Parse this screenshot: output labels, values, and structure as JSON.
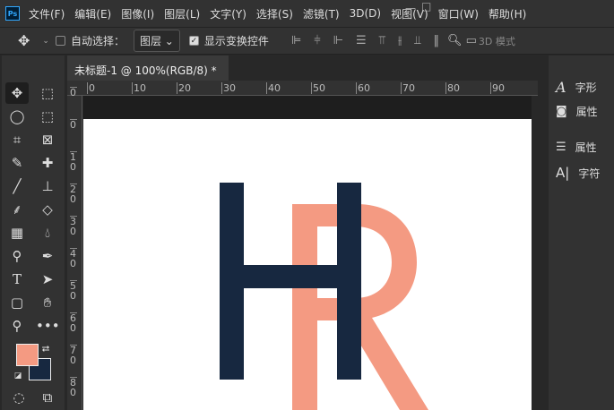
{
  "app": {
    "logo": "Ps"
  },
  "menu": [
    "文件(F)",
    "编辑(E)",
    "图像(I)",
    "图层(L)",
    "文字(Y)",
    "选择(S)",
    "滤镜(T)",
    "3D(D)",
    "视图(V)",
    "窗口(W)",
    "帮助(H)"
  ],
  "options": {
    "auto_select_label": "自动选择：",
    "auto_select_checked": false,
    "target": "图层",
    "show_transform_label": "显示变换控件",
    "show_transform_checked": true,
    "mode_3d": "3D 模式"
  },
  "document": {
    "tab_title": "未标题-1 @ 100%(RGB/8) *",
    "close": "×"
  },
  "ruler": {
    "h": [
      "0",
      "10",
      "20",
      "30",
      "40",
      "50",
      "60",
      "70",
      "80",
      "90"
    ],
    "v": [
      "0",
      "0",
      "1 0",
      "2 0",
      "3 0",
      "4 0",
      "5 0",
      "6 0",
      "7 0",
      "8 0"
    ]
  },
  "colors": {
    "foreground": "#f49a82",
    "background": "#172840"
  },
  "canvas": {
    "letter1": "H",
    "letter2": "R"
  },
  "panels": [
    {
      "icon": "glyph-icon",
      "label": "字形"
    },
    {
      "icon": "properties-icon",
      "label": "属性"
    },
    {
      "icon": "adjust-icon",
      "label": "属性"
    },
    {
      "icon": "character-icon",
      "label": "字符"
    }
  ]
}
